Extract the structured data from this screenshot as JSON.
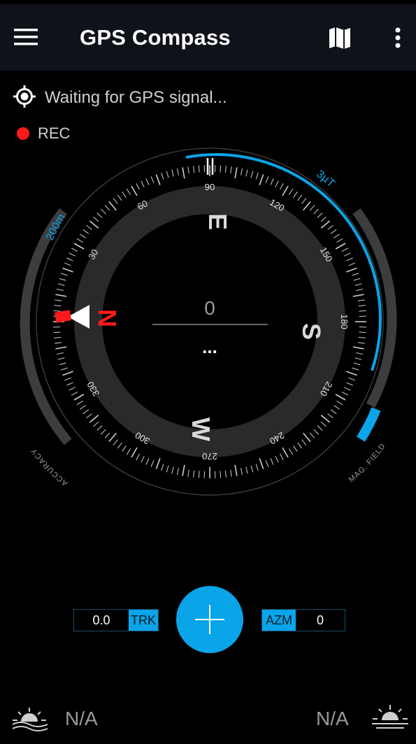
{
  "app": {
    "title": "GPS Compass"
  },
  "toolbar": {
    "menu_icon": "hamburger-menu-icon",
    "map_icon": "map-icon",
    "more_icon": "more-vert-icon"
  },
  "status": {
    "gps_text": "Waiting for GPS signal...",
    "gps_icon": "gps-location-icon",
    "rec_label": "REC",
    "rec_color": "#ff1a1a"
  },
  "compass": {
    "heading_value": "0",
    "secondary_value": "...",
    "cardinals": {
      "north": "N",
      "east": "E",
      "south": "S",
      "west": "W"
    },
    "degree_labels": [
      "30",
      "60",
      "90",
      "120",
      "150",
      "180",
      "210",
      "240",
      "270",
      "300",
      "330"
    ],
    "accuracy_label": "ACCURACY",
    "accuracy_value": "200m",
    "mag_field_label": "MAG. FIELD",
    "mag_field_value": "3µT",
    "accent_color": "#0aa4e8",
    "north_color": "#ff1a1a"
  },
  "controls": {
    "trk_value": "0.0",
    "trk_label": "TRK",
    "azm_label": "AZM",
    "azm_value": "0",
    "add_icon": "plus-icon"
  },
  "footer": {
    "sunrise_value": "N/A",
    "sunset_value": "N/A",
    "sunrise_icon": "sunrise-icon",
    "sunset_icon": "sunset-icon"
  }
}
